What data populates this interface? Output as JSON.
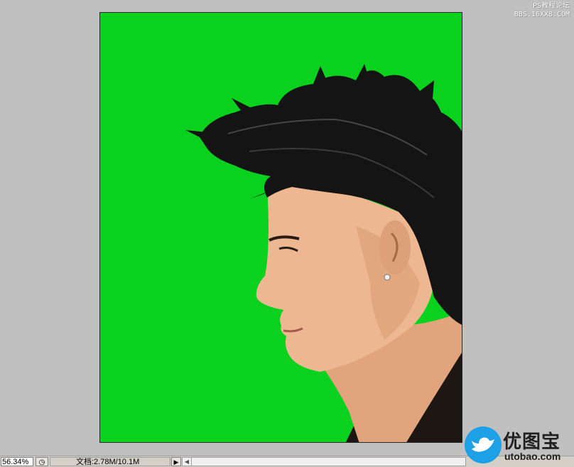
{
  "watermark_top": {
    "line1": "PS教程论坛",
    "line2": "BBS.16XX8.COM"
  },
  "canvas": {
    "background_color": "#0ad01e",
    "photo_subject": "portrait of man in profile with spiky black hair"
  },
  "statusbar": {
    "zoom": "56.34%",
    "doc_info": "文档:2.78M/10.1M",
    "play_icon": "play-arrow-icon",
    "scroll_left_icon": "scroll-left-arrow-icon"
  },
  "logo": {
    "title": "优图宝",
    "subtitle": "utobao.com",
    "brand_color": "#1ea0e6"
  }
}
